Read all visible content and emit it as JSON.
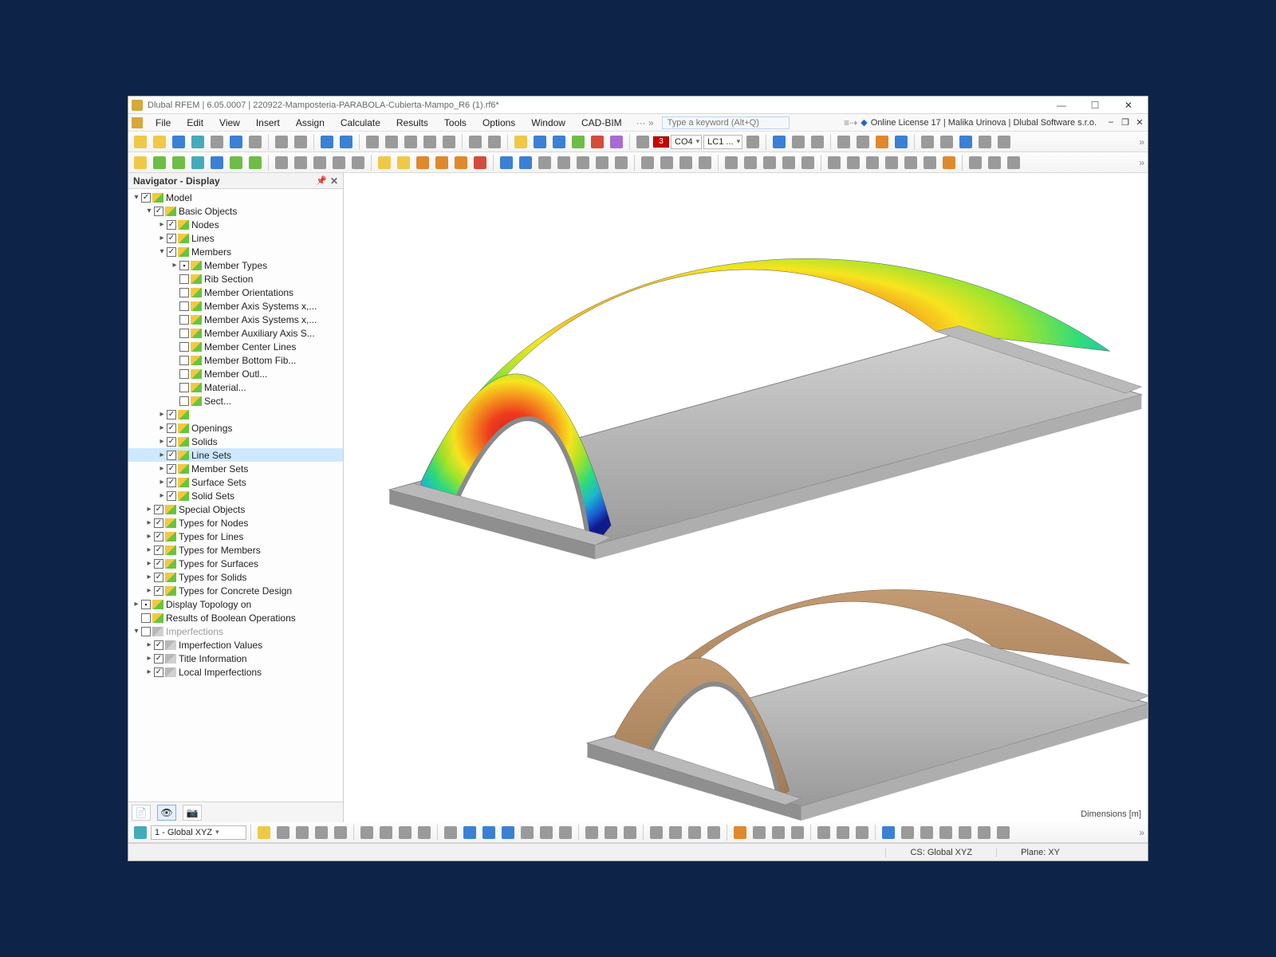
{
  "title": "Dlubal RFEM | 6.05.0007 | 220922-Mamposteria-PARABOLA-Cubierta-Mampo_R6 (1).rf6*",
  "minimize_glyph": "—",
  "maximize_glyph": "☐",
  "close_glyph": "✕",
  "menu": {
    "items": [
      "File",
      "Edit",
      "View",
      "Insert",
      "Assign",
      "Calculate",
      "Results",
      "Tools",
      "Options",
      "Window",
      "CAD-BIM"
    ],
    "more": "··· »",
    "search_placeholder": "Type a keyword (Alt+Q)",
    "right_text": "Online License 17 | Malika Urinova | Dlubal Software s.r.o.",
    "dash": "–",
    "restore": "❐",
    "close": "✕"
  },
  "tb1": {
    "co_badge": "3",
    "co_label": "CO4",
    "lc_label": "LC1 ..."
  },
  "tb3": {
    "cs_select": "1 - Global XYZ"
  },
  "navigator": {
    "title": "Navigator - Display",
    "tree": [
      {
        "d": 0,
        "tw": "v",
        "cb": "chk",
        "icon": 1,
        "label": "Model"
      },
      {
        "d": 1,
        "tw": "v",
        "cb": "chk",
        "icon": 1,
        "label": "Basic Objects"
      },
      {
        "d": 2,
        "tw": ">",
        "cb": "chk",
        "icon": 1,
        "label": "Nodes"
      },
      {
        "d": 2,
        "tw": ">",
        "cb": "chk",
        "icon": 1,
        "label": "Lines"
      },
      {
        "d": 2,
        "tw": "v",
        "cb": "chk",
        "icon": 1,
        "label": "Members"
      },
      {
        "d": 3,
        "tw": ">",
        "cb": "sq",
        "icon": 1,
        "label": "Member Types"
      },
      {
        "d": 3,
        "tw": " ",
        "cb": "",
        "icon": 1,
        "label": "Rib Section"
      },
      {
        "d": 3,
        "tw": " ",
        "cb": "",
        "icon": 1,
        "label": "Member Orientations"
      },
      {
        "d": 3,
        "tw": " ",
        "cb": "",
        "icon": 1,
        "label": "Member Axis Systems x,..."
      },
      {
        "d": 3,
        "tw": " ",
        "cb": "",
        "icon": 1,
        "label": "Member Axis Systems x,..."
      },
      {
        "d": 3,
        "tw": " ",
        "cb": "",
        "icon": 1,
        "label": "Member Auxiliary Axis S..."
      },
      {
        "d": 3,
        "tw": " ",
        "cb": "",
        "icon": 1,
        "label": "Member Center Lines"
      },
      {
        "d": 3,
        "tw": " ",
        "cb": "",
        "icon": 1,
        "label": "Member Bottom Fib..."
      },
      {
        "d": 3,
        "tw": " ",
        "cb": "",
        "icon": 1,
        "label": "Member Outl..."
      },
      {
        "d": 3,
        "tw": " ",
        "cb": "",
        "icon": 1,
        "label": "Material..."
      },
      {
        "d": 3,
        "tw": " ",
        "cb": "",
        "icon": 1,
        "label": "Sect..."
      },
      {
        "d": 2,
        "tw": ">",
        "cb": "chk",
        "icon": 1,
        "label": ""
      },
      {
        "d": 2,
        "tw": ">",
        "cb": "chk",
        "icon": 1,
        "label": "Openings"
      },
      {
        "d": 2,
        "tw": ">",
        "cb": "chk",
        "icon": 1,
        "label": "Solids"
      },
      {
        "d": 2,
        "tw": ">",
        "cb": "chk",
        "icon": 1,
        "label": "Line Sets",
        "sel": true
      },
      {
        "d": 2,
        "tw": ">",
        "cb": "chk",
        "icon": 1,
        "label": "Member Sets"
      },
      {
        "d": 2,
        "tw": ">",
        "cb": "chk",
        "icon": 1,
        "label": "Surface Sets"
      },
      {
        "d": 2,
        "tw": ">",
        "cb": "chk",
        "icon": 1,
        "label": "Solid Sets"
      },
      {
        "d": 1,
        "tw": ">",
        "cb": "chk",
        "icon": 1,
        "label": "Special Objects"
      },
      {
        "d": 1,
        "tw": ">",
        "cb": "chk",
        "icon": 1,
        "label": "Types for Nodes"
      },
      {
        "d": 1,
        "tw": ">",
        "cb": "chk",
        "icon": 1,
        "label": "Types for Lines"
      },
      {
        "d": 1,
        "tw": ">",
        "cb": "chk",
        "icon": 1,
        "label": "Types for Members"
      },
      {
        "d": 1,
        "tw": ">",
        "cb": "chk",
        "icon": 1,
        "label": "Types for Surfaces"
      },
      {
        "d": 1,
        "tw": ">",
        "cb": "chk",
        "icon": 1,
        "label": "Types for Solids"
      },
      {
        "d": 1,
        "tw": ">",
        "cb": "chk",
        "icon": 1,
        "label": "Types for Concrete Design"
      },
      {
        "d": 0,
        "tw": ">",
        "cb": "sq",
        "icon": 1,
        "label": "Display Topology on"
      },
      {
        "d": 0,
        "tw": " ",
        "cb": "",
        "icon": 1,
        "label": "Results of Boolean Operations"
      },
      {
        "d": 0,
        "tw": "v",
        "cb": "",
        "icon": 2,
        "label": "Imperfections",
        "dim": true
      },
      {
        "d": 1,
        "tw": ">",
        "cb": "chk",
        "icon": 2,
        "label": "Imperfection Values"
      },
      {
        "d": 1,
        "tw": ">",
        "cb": "chk",
        "icon": 2,
        "label": "Title Information"
      },
      {
        "d": 1,
        "tw": ">",
        "cb": "chk",
        "icon": 2,
        "label": "Local Imperfections"
      }
    ]
  },
  "viewport": {
    "dim_label": "Dimensions [m]"
  },
  "status": {
    "cs": "CS: Global XYZ",
    "plane": "Plane: XY"
  }
}
